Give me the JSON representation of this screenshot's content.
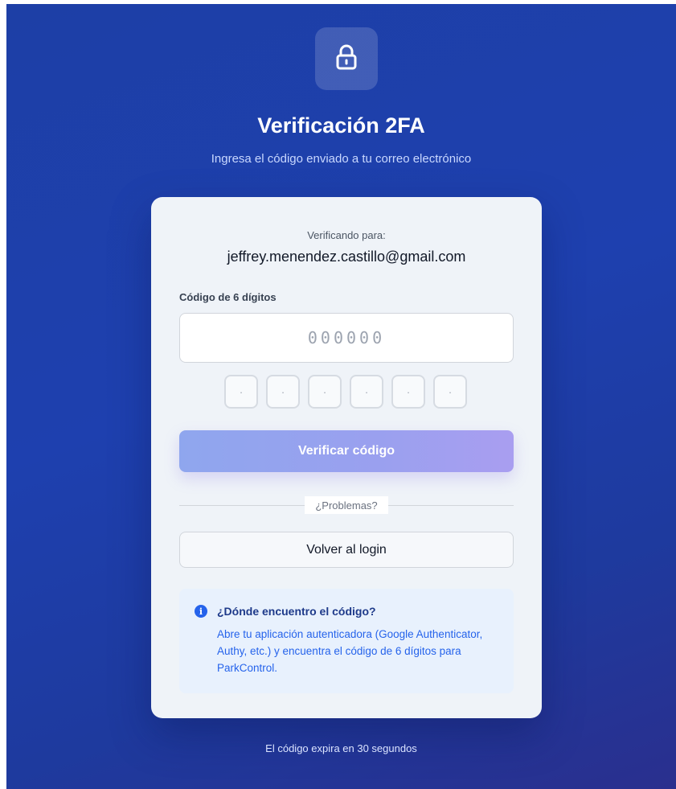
{
  "header": {
    "title": "Verificación 2FA",
    "subtitle": "Ingresa el código enviado a tu correo electrónico",
    "icon": "lock-icon"
  },
  "card": {
    "verifying_label": "Verificando para:",
    "email": "jeffrey.menendez.castillo@gmail.com",
    "code_label": "Código de 6 dígitos",
    "code_input": {
      "value": "",
      "placeholder": "000000"
    },
    "digit_boxes": [
      "·",
      "·",
      "·",
      "·",
      "·",
      "·"
    ],
    "verify_button": "Verificar código",
    "divider_text": "¿Problemas?",
    "back_button": "Volver al login",
    "info": {
      "icon": "info-icon",
      "title": "¿Dónde encuentro el código?",
      "text": "Abre tu aplicación autenticadora (Google Authenticator, Authy, etc.) y encuentra el código de 6 dígitos para ParkControl."
    }
  },
  "footer": {
    "text": "El código expira en 30 segundos"
  },
  "colors": {
    "background": "#1e40af",
    "card": "#eff3f8",
    "accent": "#2563eb",
    "button_gradient_start": "#8fa6ee",
    "button_gradient_end": "#a99ef0"
  }
}
